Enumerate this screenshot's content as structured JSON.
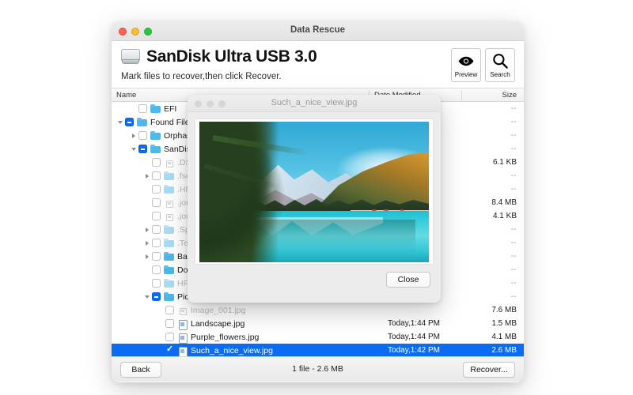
{
  "window": {
    "title": "Data Rescue",
    "traffic_lights": [
      "close-red",
      "minimize-yellow",
      "zoom-green"
    ]
  },
  "header": {
    "drive_icon": "hard-drive-icon",
    "drive_name": "SanDisk Ultra USB 3.0",
    "instruction": "Mark files to recover,then click Recover.",
    "buttons": [
      {
        "id": "preview",
        "label": "Preview",
        "icon": "eye-icon"
      },
      {
        "id": "search",
        "label": "Search",
        "icon": "magnifier-icon"
      }
    ]
  },
  "columns": {
    "name": "Name",
    "date_modified": "Date Modified",
    "size": "Size"
  },
  "rows": [
    {
      "name": "EFI",
      "indent": 1,
      "tri": "none",
      "check": "off",
      "icon": "folder",
      "dim": false,
      "date": "",
      "size": "--"
    },
    {
      "name": "Found Files",
      "indent": 0,
      "tri": "open",
      "check": "mixed",
      "icon": "folder",
      "dim": false,
      "date": "",
      "size": "--"
    },
    {
      "name": "Orphaned",
      "indent": 1,
      "tri": "closed",
      "check": "off",
      "icon": "folder",
      "dim": false,
      "date": "",
      "size": "--"
    },
    {
      "name": "SanDisk Ultra",
      "indent": 1,
      "tri": "open",
      "check": "mixed",
      "icon": "folder",
      "dim": false,
      "date": "",
      "size": "--"
    },
    {
      "name": ".DS_Store",
      "indent": 2,
      "tri": "none",
      "check": "off",
      "icon": "doc",
      "dim": true,
      "date": "",
      "size": "6.1 KB"
    },
    {
      "name": ".fseventsd",
      "indent": 2,
      "tri": "closed",
      "check": "off",
      "icon": "folder",
      "dim": true,
      "date": "",
      "size": "--"
    },
    {
      "name": ".HFS+ Private Directory Data",
      "indent": 2,
      "tri": "none",
      "check": "off",
      "icon": "folder",
      "dim": true,
      "date": "",
      "size": "--"
    },
    {
      "name": ".journal",
      "indent": 2,
      "tri": "none",
      "check": "off",
      "icon": "doc",
      "dim": true,
      "date": "",
      "size": "8.4 MB"
    },
    {
      "name": ".journal_info_block",
      "indent": 2,
      "tri": "none",
      "check": "off",
      "icon": "doc",
      "dim": true,
      "date": "",
      "size": "4.1 KB"
    },
    {
      "name": ".Spotlight-V100",
      "indent": 2,
      "tri": "closed",
      "check": "off",
      "icon": "folder",
      "dim": true,
      "date": "",
      "size": "--"
    },
    {
      "name": ".Temporary Items",
      "indent": 2,
      "tri": "closed",
      "check": "off",
      "icon": "folder",
      "dim": true,
      "date": "",
      "size": "--"
    },
    {
      "name": "Backups",
      "indent": 2,
      "tri": "closed",
      "check": "off",
      "icon": "folder",
      "dim": false,
      "date": "",
      "size": "--"
    },
    {
      "name": "Documents",
      "indent": 2,
      "tri": "none",
      "check": "off",
      "icon": "folder",
      "dim": false,
      "date": "",
      "size": "--"
    },
    {
      "name": "HFS+ Private Data",
      "indent": 2,
      "tri": "none",
      "check": "off",
      "icon": "folder",
      "dim": true,
      "date": "",
      "size": "--"
    },
    {
      "name": "Pictures",
      "indent": 2,
      "tri": "open",
      "check": "mixed",
      "icon": "folder",
      "dim": false,
      "date": "",
      "size": "--"
    },
    {
      "name": "Image_001.jpg",
      "indent": 3,
      "tri": "none",
      "check": "off",
      "icon": "doc",
      "dim": true,
      "date": "",
      "size": "7.6 MB"
    },
    {
      "name": "Landscape.jpg",
      "indent": 3,
      "tri": "none",
      "check": "off",
      "icon": "doc",
      "dim": false,
      "date": "Today,1:44 PM",
      "size": "1.5 MB"
    },
    {
      "name": "Purple_flowers.jpg",
      "indent": 3,
      "tri": "none",
      "check": "off",
      "icon": "doc",
      "dim": false,
      "date": "Today,1:44 PM",
      "size": "4.1 MB"
    },
    {
      "name": "Such_a_nice_view.jpg",
      "indent": 3,
      "tri": "none",
      "check": "on",
      "icon": "doc",
      "dim": false,
      "date": "Today,1:42 PM",
      "size": "2.6 MB",
      "selected": true
    }
  ],
  "bottom": {
    "back_label": "Back",
    "status": "1 file - 2.6 MB",
    "recover_label": "Recover..."
  },
  "dialog": {
    "title": "Such_a_nice_view.jpg",
    "image_alt": "turquoise mountain lake with pine trees and snowy peaks",
    "close_label": "Close"
  },
  "colors": {
    "accent": "#0a6cf5",
    "folder": "#4db8ea",
    "window_bg": "#ffffff",
    "dialog_bg": "#ececec"
  }
}
